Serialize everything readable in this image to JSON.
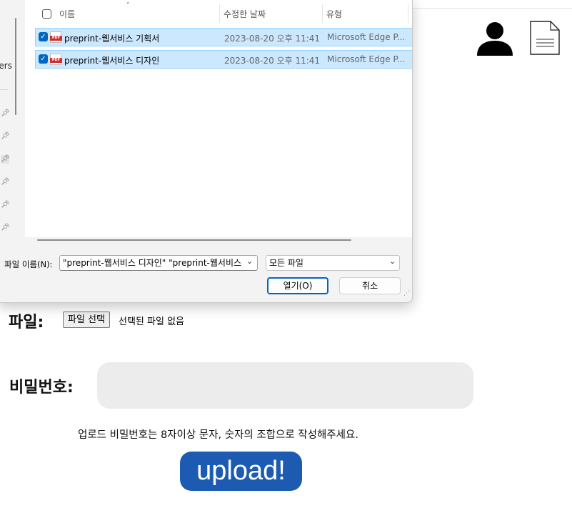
{
  "page": {
    "file_label": "파일:",
    "file_button": "파일 선택",
    "file_status": "선택된 파일 없음",
    "password_label": "비밀번호:",
    "password_value": "",
    "hint": "업로드 비밀번호는 8자이상 문자, 숫자의 조합으로 작성해주세요.",
    "upload_button": "upload!",
    "icons": [
      "user-icon",
      "document-icon"
    ]
  },
  "dialog": {
    "nav_partial_text": "ers",
    "columns": {
      "name": "이름",
      "date": "수정한 날짜",
      "type": "유형"
    },
    "files": [
      {
        "name": "preprint-웹서비스 기획서",
        "date": "2023-08-20 오후 11:41",
        "type": "Microsoft Edge P...",
        "checked": true
      },
      {
        "name": "preprint-웹서비스 디자인",
        "date": "2023-08-20 오후 11:41",
        "type": "Microsoft Edge P...",
        "checked": true
      }
    ],
    "filename_label": "파일 이름(N):",
    "filename_value": "\"preprint-웹서비스 디자인\" \"preprint-웹서비스",
    "filetype_value": "모든 파일",
    "open_button": "열기(O)",
    "cancel_button": "취소",
    "accent_color": "#0067c0",
    "selection_color": "#cce8ff"
  }
}
